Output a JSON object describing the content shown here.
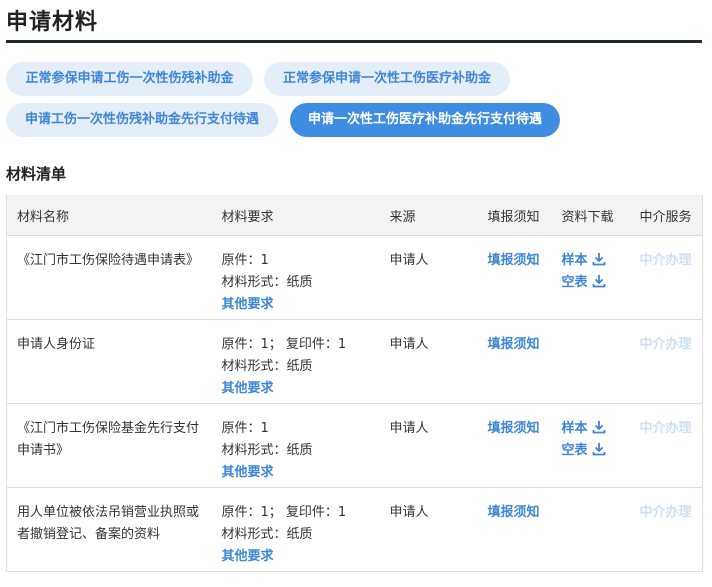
{
  "page_title": "申请材料",
  "tabs": [
    {
      "label": "正常参保申请工伤一次性伤残补助金",
      "active": false
    },
    {
      "label": "正常参保申请一次性工伤医疗补助金",
      "active": false
    },
    {
      "label": "申请工伤一次性伤残补助金先行支付待遇",
      "active": false
    },
    {
      "label": "申请一次性工伤医疗补助金先行支付待遇",
      "active": true
    }
  ],
  "section_title": "材料清单",
  "table": {
    "headers": [
      "材料名称",
      "材料要求",
      "来源",
      "填报须知",
      "资料下载",
      "中介服务"
    ],
    "rows": [
      {
        "name": "《江门市工伤保险待遇申请表》",
        "req1": "原件：1",
        "req2": "材料形式：纸质",
        "req_more": "其他要求",
        "source": "申请人",
        "notice": "填报须知",
        "sample": "样本",
        "blank": "空表",
        "agency": "中介办理"
      },
      {
        "name": "申请人身份证",
        "req1": "原件：1； 复印件：1",
        "req2": "材料形式：纸质",
        "req_more": "其他要求",
        "source": "申请人",
        "notice": "填报须知",
        "sample": "",
        "blank": "",
        "agency": "中介办理"
      },
      {
        "name": "《江门市工伤保险基金先行支付申请书》",
        "req1": "原件：1",
        "req2": "材料形式：纸质",
        "req_more": "其他要求",
        "source": "申请人",
        "notice": "填报须知",
        "sample": "样本",
        "blank": "空表",
        "agency": "中介办理"
      },
      {
        "name": "用人单位被依法吊销营业执照或者撤销登记、备案的资料",
        "req1": "原件：1； 复印件：1",
        "req2": "材料形式：纸质",
        "req_more": "其他要求",
        "source": "申请人",
        "notice": "填报须知",
        "sample": "",
        "blank": "",
        "agency": "中介办理"
      }
    ]
  },
  "icons": {
    "download": "download-icon"
  },
  "colors": {
    "accent": "#3e8de0",
    "pill_bg": "#e4eef9",
    "disabled_link": "#cfe0f3"
  }
}
